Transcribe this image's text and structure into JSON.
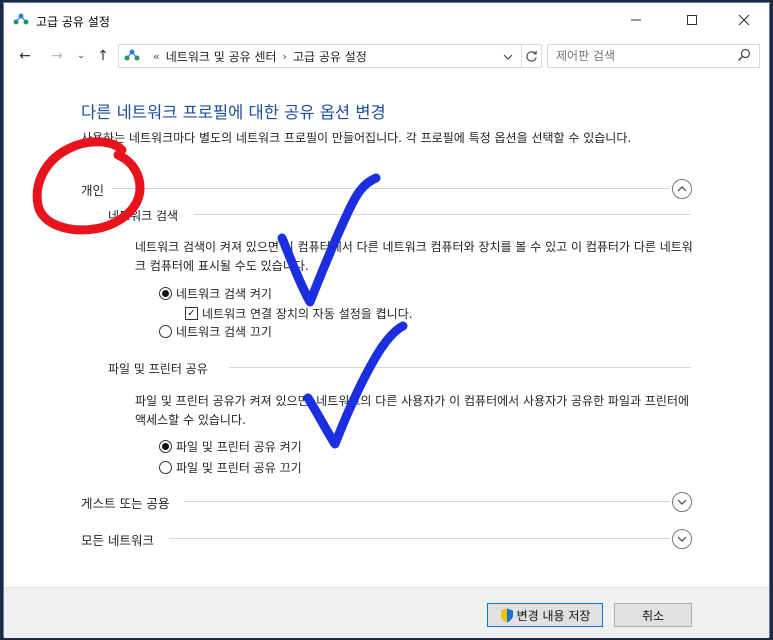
{
  "window": {
    "title": "고급 공유 설정"
  },
  "nav": {
    "back": "←",
    "forward": "→",
    "history": "⌄",
    "up": "↑",
    "breadcrumb_prefix": "«",
    "breadcrumbs": [
      "네트워크 및 공유 센터",
      "고급 공유 설정"
    ],
    "separator": "›",
    "search_placeholder": "제어판 검색"
  },
  "content": {
    "title": "다른 네트워크 프로필에 대한 공유 옵션 변경",
    "intro": "사용하는 네트워크마다 별도의 네트워크 프로필이 만들어집니다. 각 프로필에 특정 옵션을 선택할 수 있습니다.",
    "private": {
      "label": "개인",
      "discovery": {
        "label": "네트워크 검색",
        "desc": "네트워크 검색이 켜져 있으면 이 컴퓨터에서 다른 네트워크 컴퓨터와 장치를 볼 수 있고 이 컴퓨터가 다른 네트워크 컴퓨터에 표시될 수도 있습니다.",
        "on": "네트워크 검색 켜기",
        "auto_setup": "네트워크 연결 장치의 자동 설정을 켭니다.",
        "off": "네트워크 검색 끄기"
      },
      "fps": {
        "label": "파일 및 프린터 공유",
        "desc": "파일 및 프린터 공유가 켜져 있으면, 네트워크의 다른 사용자가 이 컴퓨터에서 사용자가 공유한 파일과 프린터에 액세스할 수 있습니다.",
        "on": "파일 및 프린터 공유 켜기",
        "off": "파일 및 프린터 공유 끄기"
      }
    },
    "guest": {
      "label": "게스트 또는 공용"
    },
    "all": {
      "label": "모든 네트워크"
    }
  },
  "footer": {
    "save": "변경 내용 저장",
    "cancel": "취소"
  },
  "colors": {
    "title_blue": "#1a4f9c",
    "annot_red": "#e8131c",
    "annot_blue": "#1b2fe0"
  }
}
